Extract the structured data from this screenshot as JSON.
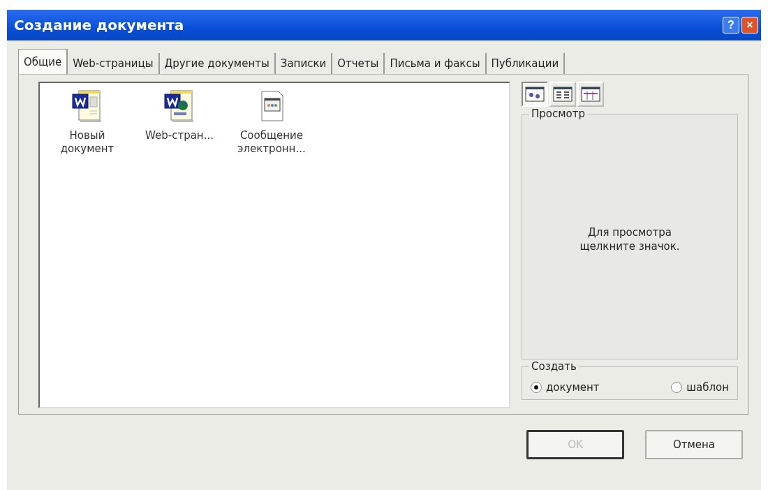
{
  "window": {
    "title": "Создание документа",
    "buttons": [
      {
        "kind": "help",
        "label": "?"
      },
      {
        "kind": "close",
        "label": "×"
      }
    ]
  },
  "tabs": [
    {
      "label": "Общие",
      "selected": true
    },
    {
      "label": "Web-страницы",
      "selected": false
    },
    {
      "label": "Другие документы",
      "selected": false
    },
    {
      "label": "Записки",
      "selected": false
    },
    {
      "label": "Отчеты",
      "selected": false
    },
    {
      "label": "Письма и факсы",
      "selected": false
    },
    {
      "label": "Публикации",
      "selected": false
    }
  ],
  "templates": [
    {
      "kind": "word",
      "label": "Новый документ",
      "selected": false
    },
    {
      "kind": "web",
      "label": "Web-стран...",
      "selected": false
    },
    {
      "kind": "email",
      "label": "Сообщение электронн...",
      "selected": false
    }
  ],
  "view_buttons": [
    {
      "kind": "large",
      "selected": true
    },
    {
      "kind": "list",
      "selected": false
    },
    {
      "kind": "details",
      "selected": false
    }
  ],
  "preview": {
    "title": "Просмотр",
    "hint": "Для просмотра щелкните значок."
  },
  "create": {
    "title": "Создать",
    "options": [
      {
        "label": "документ",
        "selected": true
      },
      {
        "label": "шаблон",
        "selected": false
      }
    ]
  },
  "buttons": [
    {
      "label": "OK",
      "disabled": true,
      "default": true
    },
    {
      "label": "Отмена",
      "disabled": false,
      "default": false
    }
  ]
}
